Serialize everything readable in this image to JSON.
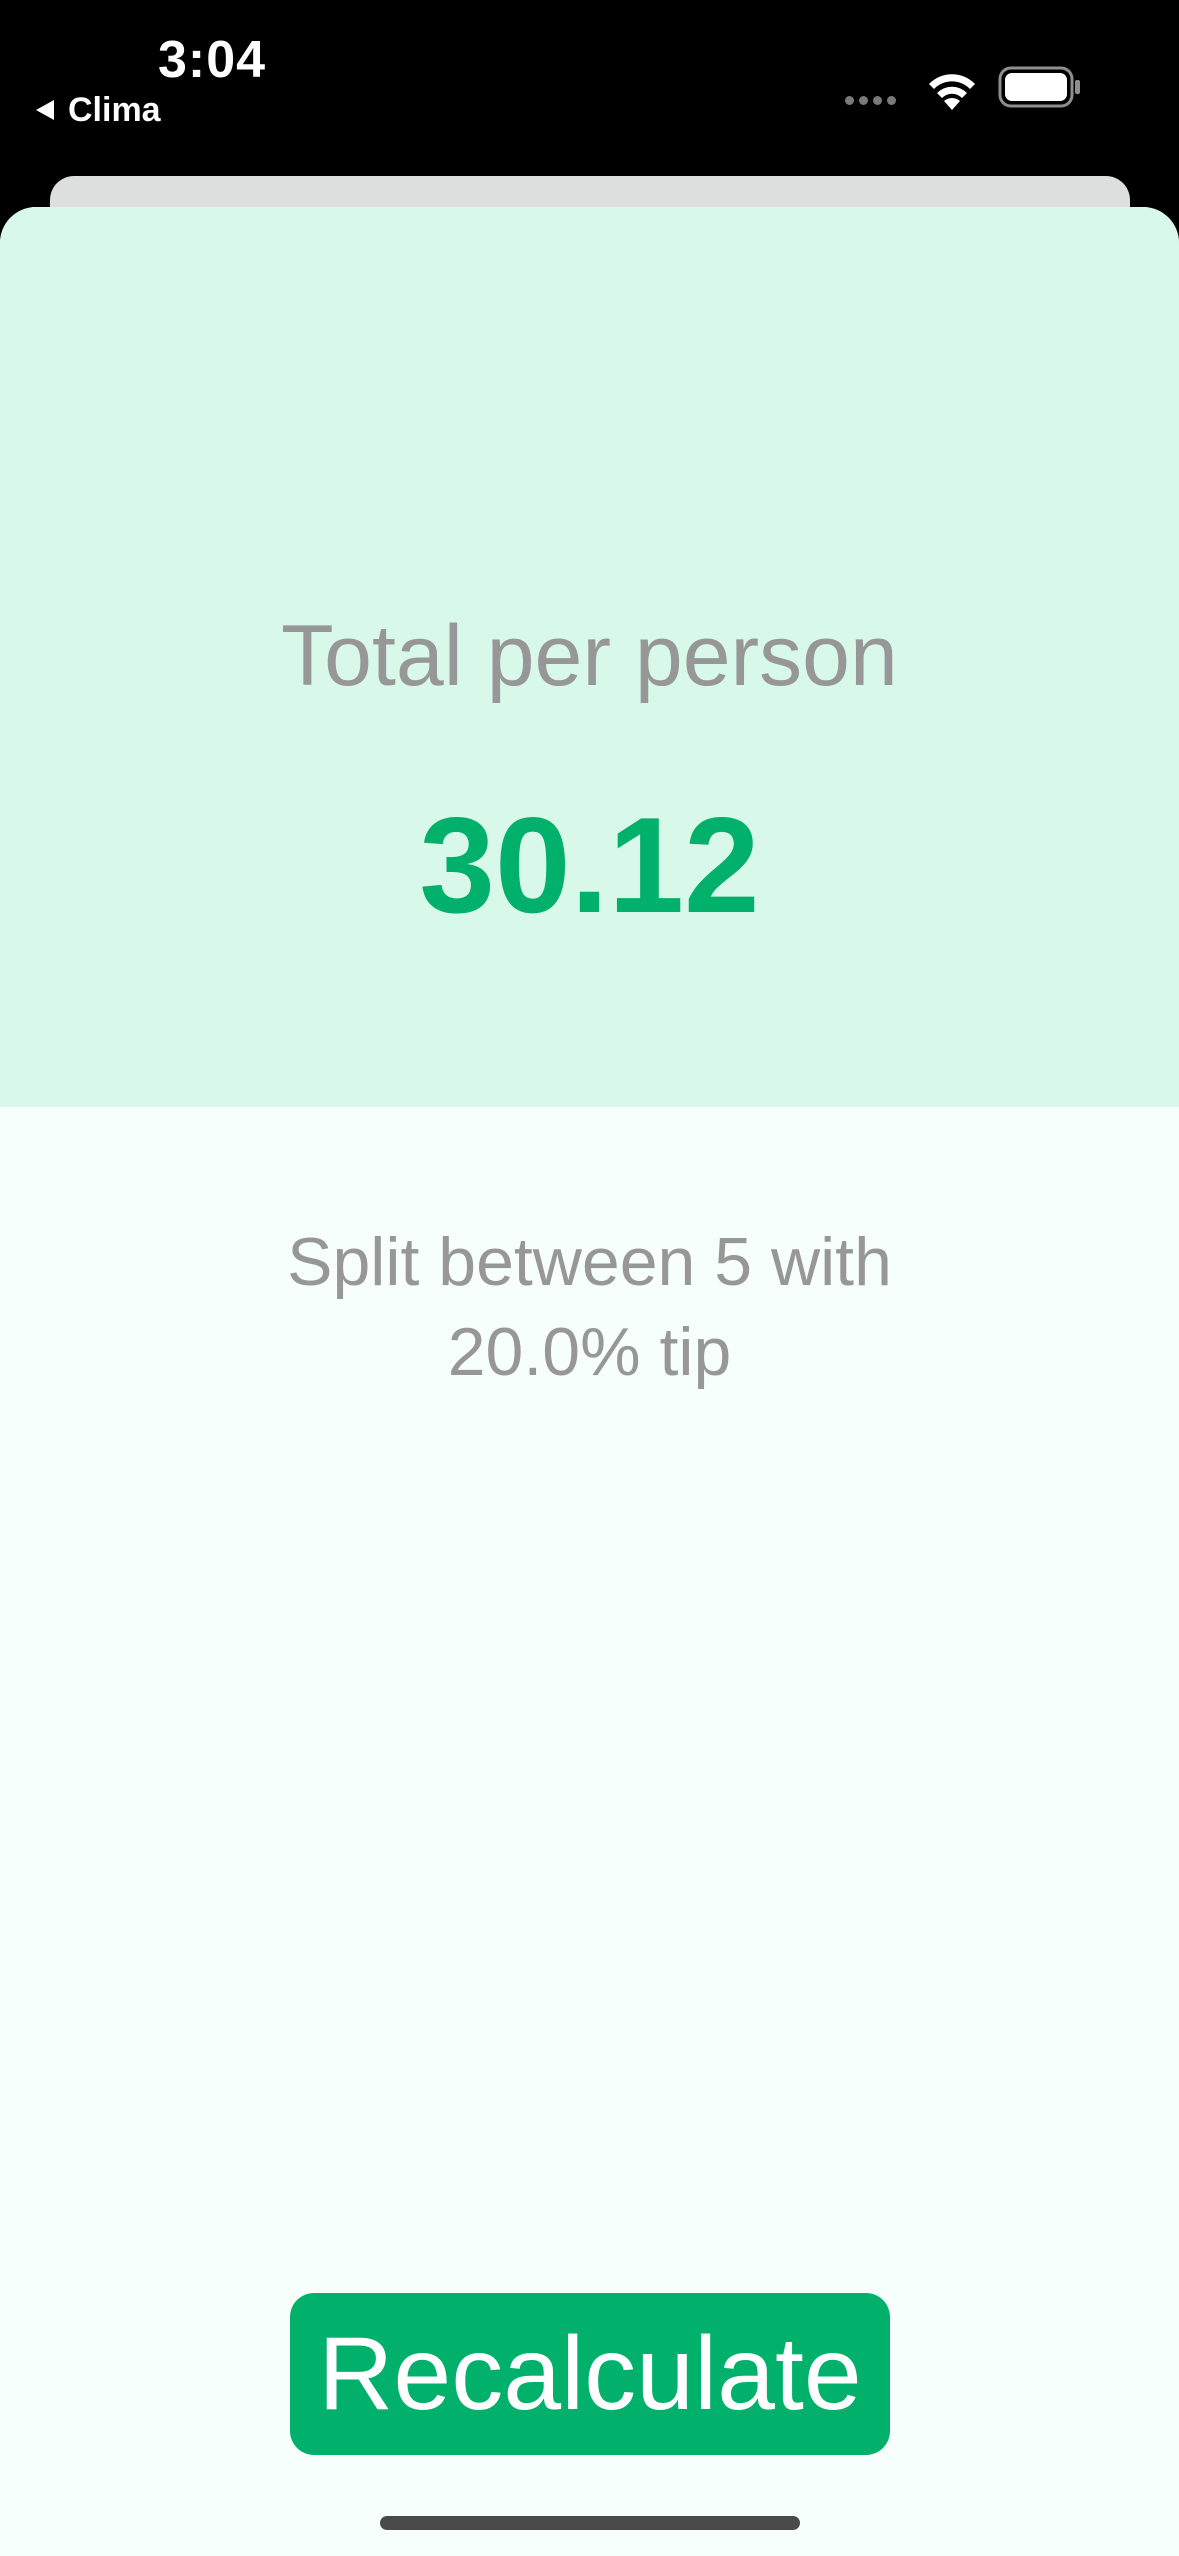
{
  "status_bar": {
    "time": "3:04",
    "back_app": "Clima",
    "icons": [
      "back-arrow-icon",
      "signal-dots-icon",
      "wifi-icon",
      "battery-icon"
    ]
  },
  "result": {
    "title": "Total per person",
    "value": "30.12",
    "settings": "Split between 5 with 20.0% tip"
  },
  "actions": {
    "recalculate_label": "Recalculate"
  },
  "colors": {
    "accent": "#00b06b",
    "top_panel": "#d8f8ea",
    "background": "#f7fffc",
    "secondary_text": "#979797"
  }
}
